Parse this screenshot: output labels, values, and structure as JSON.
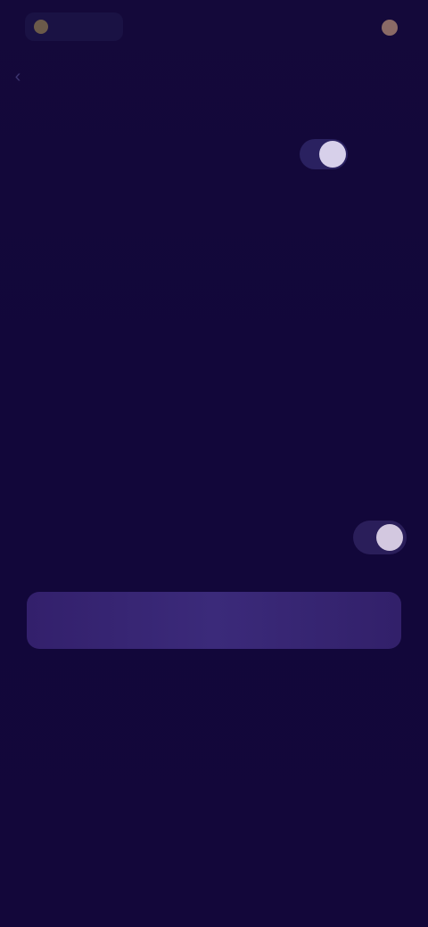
{
  "status_bar": {
    "time": "",
    "right_text": ""
  },
  "nav": {
    "back_icon": "chevron-left-icon",
    "title": ""
  },
  "toggle_1": {
    "label": "",
    "on": true
  },
  "section_1": {
    "heading": "",
    "paragraphs": [
      "",
      ""
    ]
  },
  "toggle_2": {
    "label": "",
    "on": true
  },
  "cta": {
    "label": ""
  },
  "section_2": {
    "heading": "",
    "paragraph": ""
  },
  "colors": {
    "background": "#12073a",
    "accent": "#3b2a7a",
    "knob": "#d7d0ea"
  }
}
